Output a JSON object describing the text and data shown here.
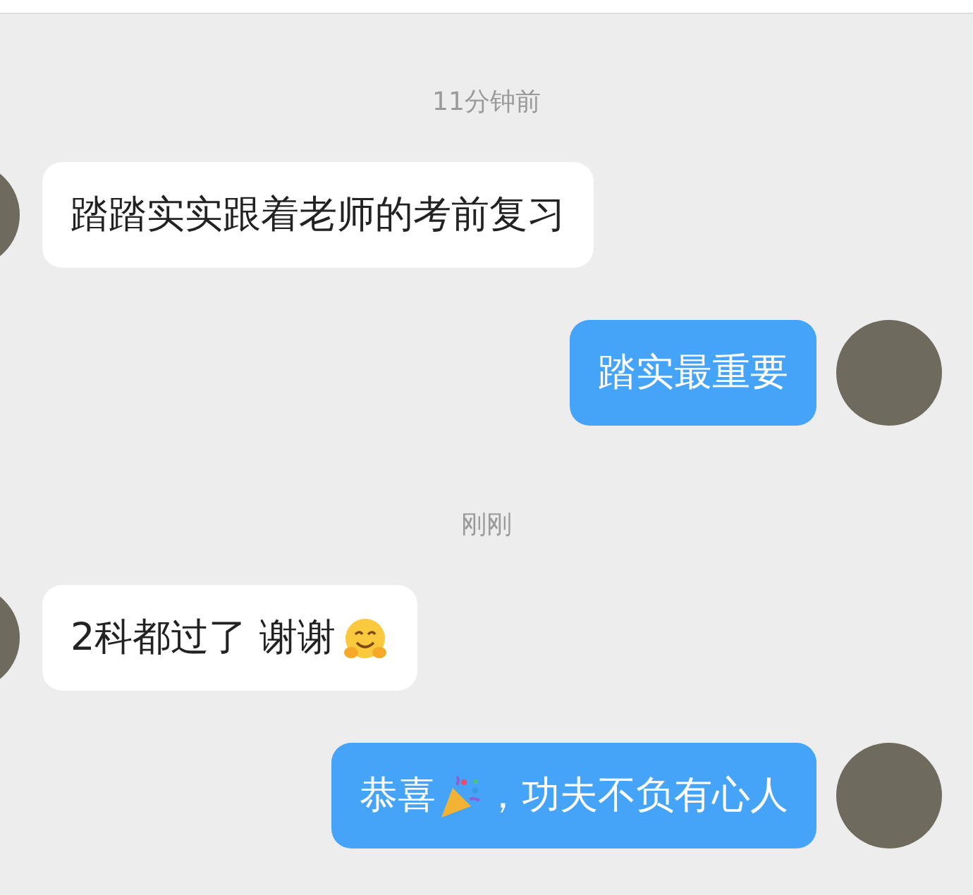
{
  "items": [
    {
      "kind": "time",
      "text": "11分钟前"
    },
    {
      "kind": "message",
      "mine": false,
      "parts": [
        {
          "kind": "text",
          "text": "踏踏实实跟着老师的考前复习"
        }
      ]
    },
    {
      "kind": "message",
      "mine": true,
      "parts": [
        {
          "kind": "text",
          "text": "踏实最重要"
        }
      ]
    },
    {
      "kind": "time",
      "text": "刚刚"
    },
    {
      "kind": "message",
      "mine": false,
      "parts": [
        {
          "kind": "text",
          "text": "2科都过了 谢谢"
        },
        {
          "kind": "hug"
        }
      ]
    },
    {
      "kind": "message",
      "mine": true,
      "parts": [
        {
          "kind": "text",
          "text": "恭喜"
        },
        {
          "kind": "popper"
        },
        {
          "kind": "text",
          "text": "，功夫不负有心人"
        }
      ]
    }
  ]
}
